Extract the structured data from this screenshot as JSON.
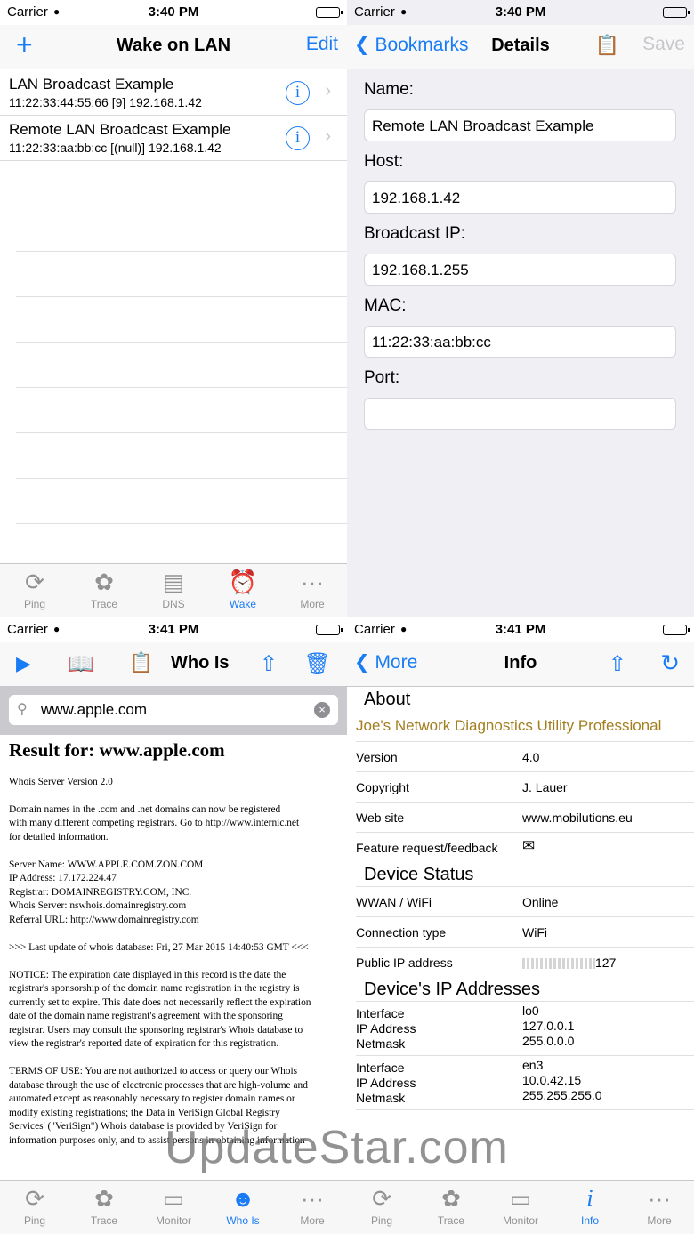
{
  "q1": {
    "status": {
      "carrier": "Carrier",
      "time": "3:40 PM"
    },
    "nav": {
      "left": "+",
      "title": "Wake on LAN",
      "right": "Edit"
    },
    "rows": [
      {
        "name": "LAN Broadcast Example",
        "detail": "11:22:33:44:55:66 [9]    192.168.1.42"
      },
      {
        "name": "Remote LAN Broadcast Example",
        "detail": "11:22:33:aa:bb:cc [(null)]    192.168.1.42"
      }
    ],
    "tabs": [
      "Ping",
      "Trace",
      "DNS",
      "Wake",
      "More"
    ]
  },
  "q2": {
    "status": {
      "carrier": "Carrier",
      "time": "3:40 PM"
    },
    "nav": {
      "back": "Bookmarks",
      "title": "Details",
      "save": "Save"
    },
    "fields": [
      {
        "label": "Name:",
        "value": "Remote LAN Broadcast Example"
      },
      {
        "label": "Host:",
        "value": "192.168.1.42"
      },
      {
        "label": "Broadcast IP:",
        "value": "192.168.1.255"
      },
      {
        "label": "MAC:",
        "value": "11:22:33:aa:bb:cc"
      },
      {
        "label": "Port:",
        "value": ""
      }
    ]
  },
  "q3": {
    "status": {
      "carrier": "Carrier",
      "time": "3:41 PM"
    },
    "nav": {
      "title": "Who Is"
    },
    "search": {
      "value": "www.apple.com"
    },
    "result_title": "Result for: www.apple.com",
    "paragraphs": [
      "Whois Server Version 2.0",
      "Domain names in the .com and .net domains can now be registered\nwith many different competing registrars. Go to http://www.internic.net\nfor detailed information.",
      "Server Name: WWW.APPLE.COM.ZON.COM\nIP Address: 17.172.224.47\nRegistrar: DOMAINREGISTRY.COM, INC.\nWhois Server: nswhois.domainregistry.com\nReferral URL: http://www.domainregistry.com",
      ">>> Last update of whois database: Fri, 27 Mar 2015 14:40:53 GMT <<<",
      "NOTICE: The expiration date displayed in this record is the date the\nregistrar's sponsorship of the domain name registration in the registry is\ncurrently set to expire. This date does not necessarily reflect the expiration\ndate of the domain name registrant's agreement with the sponsoring\nregistrar. Users may consult the sponsoring registrar's Whois database to\nview the registrar's reported date of expiration for this registration.",
      "TERMS OF USE: You are not authorized to access or query our Whois\ndatabase through the use of electronic processes that are high-volume and\nautomated except as reasonably necessary to register domain names or\nmodify existing registrations; the Data in VeriSign Global Registry\nServices' (\"VeriSign\") Whois database is provided by VeriSign for\ninformation purposes only, and to assist persons in obtaining information"
    ],
    "tabs": [
      "Ping",
      "Trace",
      "Monitor",
      "Who Is",
      "More"
    ]
  },
  "q4": {
    "status": {
      "carrier": "Carrier",
      "time": "3:41 PM"
    },
    "nav": {
      "back": "More",
      "title": "Info"
    },
    "about_head": "About",
    "app_name": "Joe's Network Diagnostics Utility Professional",
    "about_rows": [
      {
        "k": "Version",
        "v": "4.0"
      },
      {
        "k": "Copyright",
        "v": "J. Lauer"
      },
      {
        "k": "Web site",
        "v": "www.mobilutions.eu"
      },
      {
        "k": "Feature request/feedback",
        "v": ""
      }
    ],
    "device_head": "Device Status",
    "device_rows": [
      {
        "k": "WWAN / WiFi",
        "v": "Online"
      },
      {
        "k": "Connection type",
        "v": "WiFi"
      },
      {
        "k": "Public IP address",
        "v": "127"
      }
    ],
    "ip_head": "Device's IP Addresses",
    "ip_labels": {
      "iface": "Interface",
      "ip": "IP Address",
      "mask": "Netmask"
    },
    "interfaces": [
      {
        "iface": "lo0",
        "ip": "127.0.0.1",
        "mask": "255.0.0.0"
      },
      {
        "iface": "en3",
        "ip": "10.0.42.15",
        "mask": "255.255.255.0"
      }
    ],
    "tabs": [
      "Ping",
      "Trace",
      "Monitor",
      "Info",
      "More"
    ]
  },
  "watermark": "UpdateStar.com"
}
